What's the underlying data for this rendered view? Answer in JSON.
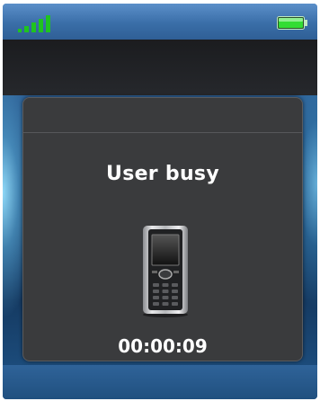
{
  "status_bar": {
    "signal_icon": "signal-strength-icon",
    "signal_bars": 4,
    "battery_icon": "battery-full-icon",
    "battery_level": 1.0,
    "signal_color": "#22cc22",
    "battery_color": "#22cc22"
  },
  "dialog": {
    "message": "User busy",
    "icon": "mobile-phone-icon",
    "timer": "00:00:09"
  }
}
